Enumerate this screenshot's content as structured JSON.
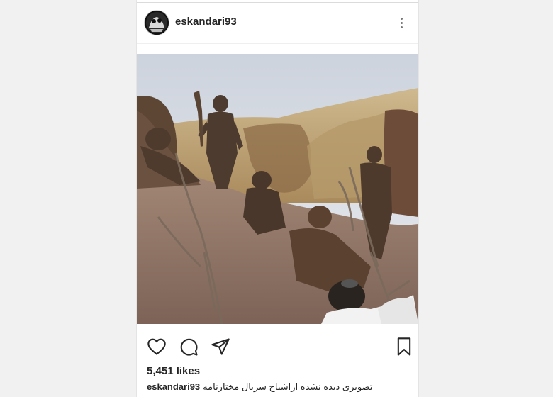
{
  "post": {
    "username": "eskandari93",
    "likes_count": "5,451",
    "likes_suffix": "likes",
    "caption_text": "تصویری دیده نشده ازاشباح سریال مختارنامه"
  },
  "icons": {
    "more": "more-vertical-icon",
    "like": "heart-icon",
    "comment": "comment-icon",
    "share": "send-icon",
    "save": "bookmark-icon"
  },
  "colors": {
    "text": "#262626",
    "background": "#f1f1f1",
    "card": "#ffffff"
  }
}
